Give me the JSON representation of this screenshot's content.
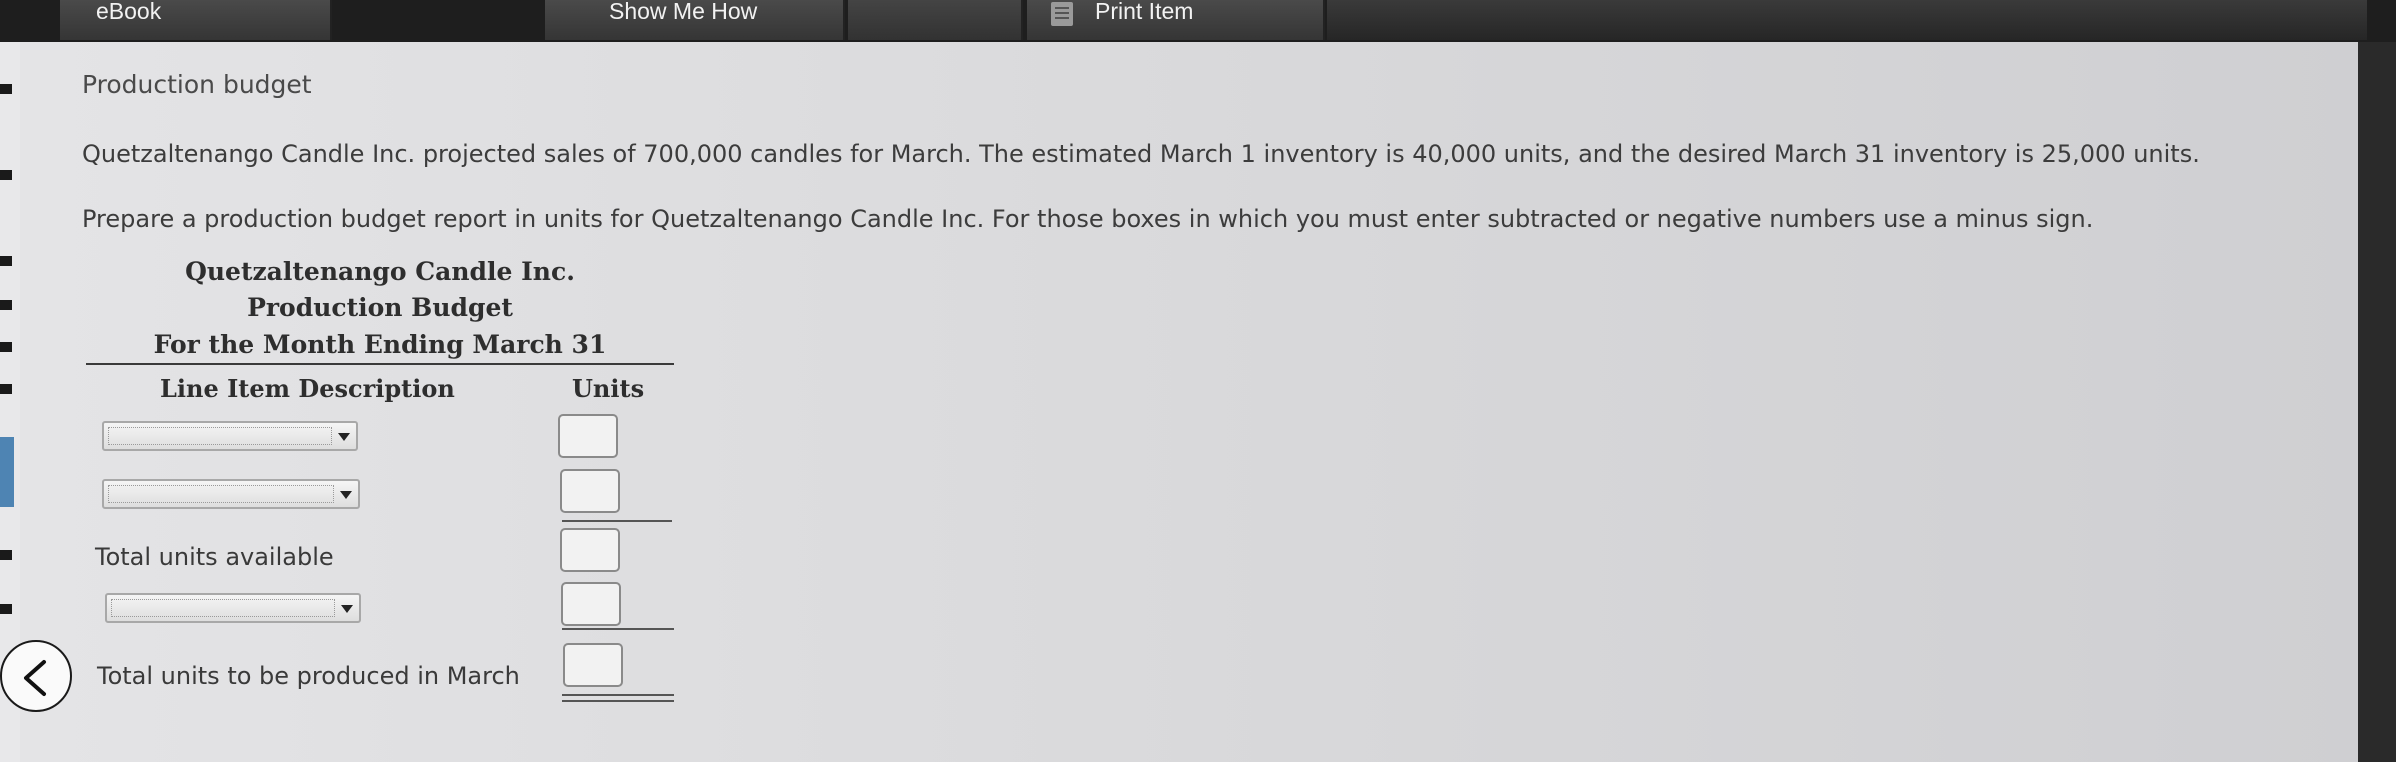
{
  "toolbar": {
    "ebook_label": "eBook",
    "show_me_how_label": "Show Me How",
    "print_item_label": "Print Item",
    "print_icon": "document-icon"
  },
  "content": {
    "title": "Production budget",
    "paragraph1": "Quetzaltenango Candle Inc. projected sales of 700,000 candles for March. The estimated March 1 inventory is 40,000 units, and the desired March 31 inventory is 25,000 units.",
    "paragraph2": "Prepare a production budget report in units for Quetzaltenango Candle Inc. For those boxes in which you must enter subtracted or negative numbers use a minus sign."
  },
  "budget": {
    "company": "Quetzaltenango Candle Inc.",
    "report_name": "Production Budget",
    "period": "For the Month Ending March 31",
    "col_description": "Line Item Description",
    "col_units": "Units",
    "rows": [
      {
        "type": "select",
        "value": "",
        "units": ""
      },
      {
        "type": "select",
        "value": "",
        "units": ""
      },
      {
        "type": "label",
        "label": "Total units available",
        "units": ""
      },
      {
        "type": "select",
        "value": "",
        "units": ""
      },
      {
        "type": "label",
        "label": "Total units to be produced in March",
        "units": ""
      }
    ]
  },
  "nav": {
    "back_icon": "chevron-left-icon"
  }
}
